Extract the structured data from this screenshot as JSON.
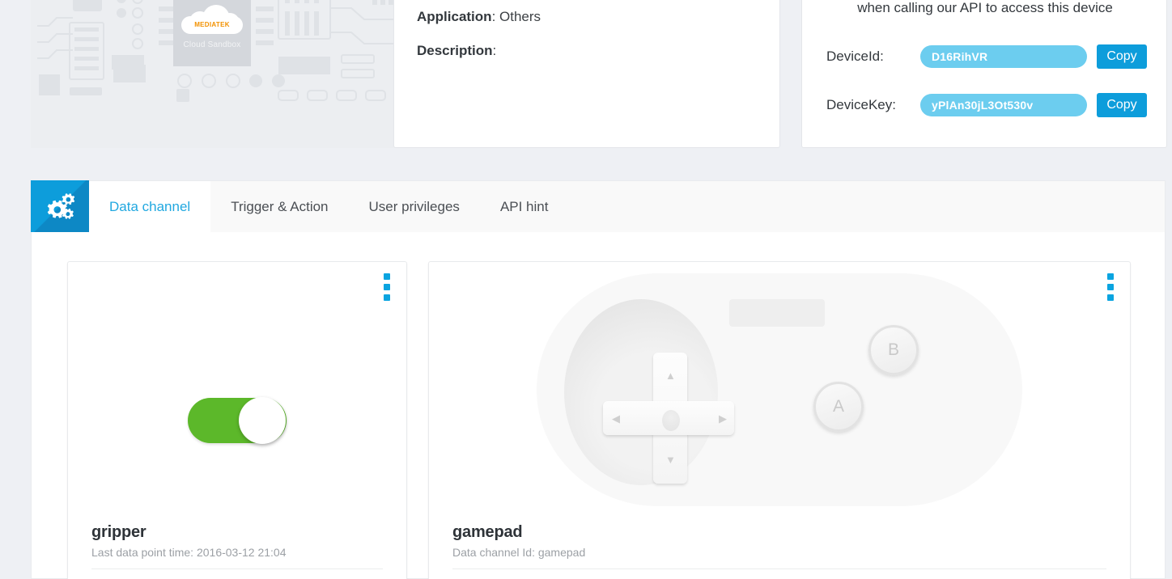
{
  "hero": {
    "logo_brand": "MEDIATEK",
    "logo_subtitle": "Cloud Sandbox"
  },
  "info": {
    "application_label": "Application",
    "application_value": ": Others",
    "description_label": "Description",
    "description_value": ":"
  },
  "credentials": {
    "note": "when calling our API to access this device",
    "device_id_label": "DeviceId:",
    "device_id_value": "D16RihVR",
    "device_key_label": "DeviceKey:",
    "device_key_value": "yPlAn30jL3Ot530v",
    "copy_label": "Copy",
    "pill_color": "#6ccdef",
    "button_color": "#0d9ddb"
  },
  "tabs": {
    "icon_name": "gears-icon",
    "icon_bg": "#0d9ddb",
    "active_color": "#21a8e0",
    "items": [
      {
        "label": "Data channel"
      },
      {
        "label": "Trigger & Action"
      },
      {
        "label": "User privileges"
      },
      {
        "label": "API hint"
      }
    ]
  },
  "channels": [
    {
      "widget": "switch",
      "title": "gripper",
      "subtitle": "Last data point time: 2016-03-12 21:04",
      "state": "on",
      "on_color": "#5cb82a",
      "menu_icon": "kebab-menu-icon"
    },
    {
      "widget": "gamepad",
      "title": "gamepad",
      "subtitle": "Data channel Id: gamepad",
      "button_a": "A",
      "button_b": "B",
      "menu_icon": "kebab-menu-icon"
    }
  ]
}
